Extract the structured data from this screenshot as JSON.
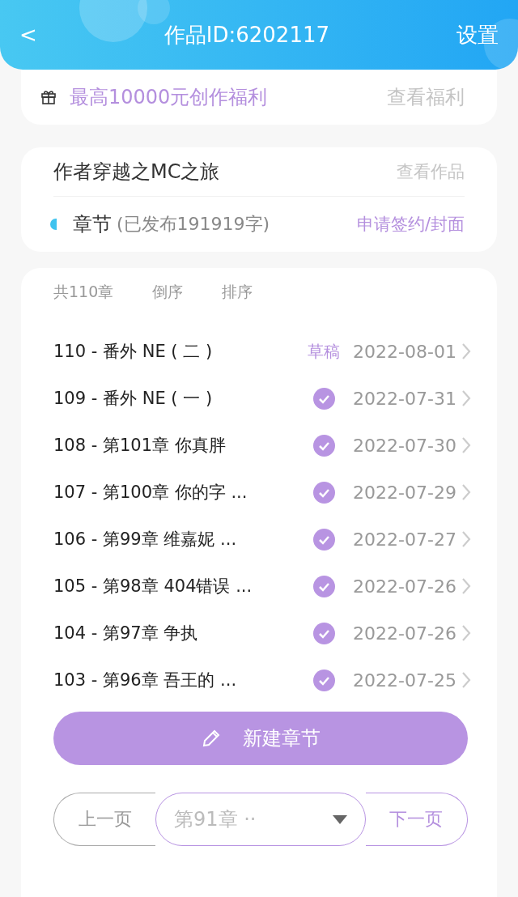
{
  "header": {
    "back": "<",
    "title": "作品ID:6202117",
    "action": "设置"
  },
  "welfare": {
    "text": "最高10000元创作福利",
    "link": "查看福利"
  },
  "work": {
    "title": "作者穿越之MC之旅",
    "link": "查看作品",
    "section": "章节",
    "published": "(已发布191919字)",
    "apply": "申请签约/封面"
  },
  "toolbar": {
    "count": "共110章",
    "items": [
      "倒序",
      "排序"
    ]
  },
  "chapters": [
    {
      "title": "110 - 番外 NE ( 二 )",
      "kind": "draft",
      "status": "草稿",
      "date": "2022-08-01"
    },
    {
      "title": "109 - 番外 NE ( 一 )",
      "kind": "published",
      "date": "2022-07-31"
    },
    {
      "title": "108 - 第101章 你真胖",
      "kind": "published",
      "date": "2022-07-30"
    },
    {
      "title": "107 - 第100章 你的字 ...",
      "kind": "published",
      "date": "2022-07-29"
    },
    {
      "title": "106 - 第99章 维嘉妮 ...",
      "kind": "published",
      "date": "2022-07-27"
    },
    {
      "title": "105 - 第98章 404错误 ...",
      "kind": "published",
      "date": "2022-07-26"
    },
    {
      "title": "104 - 第97章 争执",
      "kind": "published",
      "date": "2022-07-26"
    },
    {
      "title": "103 - 第96章 吾王的 ...",
      "kind": "published",
      "date": "2022-07-25"
    }
  ],
  "new_chapter": "新建章节",
  "pager": {
    "prev": {
      "label": "上一页",
      "disabled": true
    },
    "select": "第91章 ··",
    "next": {
      "label": "下一页",
      "disabled": false
    }
  }
}
